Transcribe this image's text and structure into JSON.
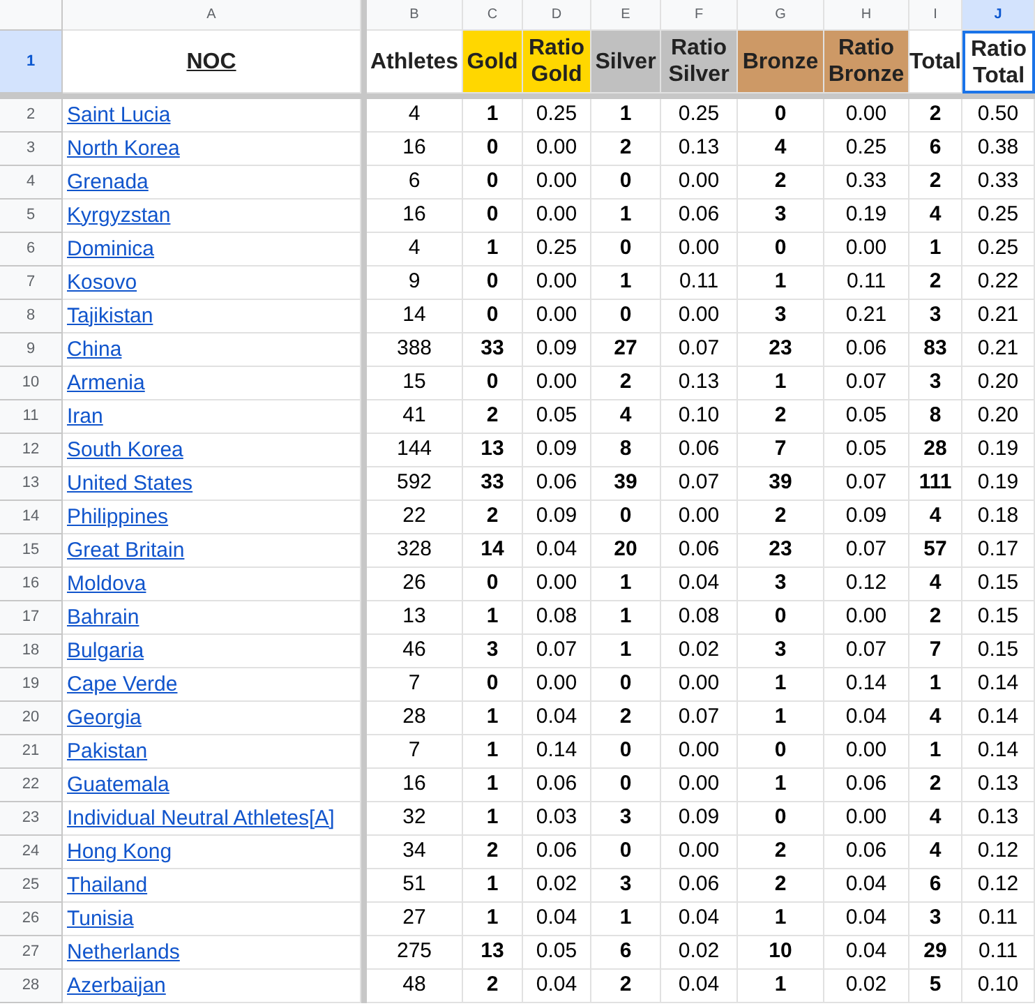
{
  "column_letters": [
    {
      "label": "A",
      "selected": false
    },
    {
      "label": "B",
      "selected": false
    },
    {
      "label": "C",
      "selected": false
    },
    {
      "label": "D",
      "selected": false
    },
    {
      "label": "E",
      "selected": false
    },
    {
      "label": "F",
      "selected": false
    },
    {
      "label": "G",
      "selected": false
    },
    {
      "label": "H",
      "selected": false
    },
    {
      "label": "I",
      "selected": false
    },
    {
      "label": "J",
      "selected": true
    }
  ],
  "header_row": {
    "row": "1",
    "selected": true,
    "cells": [
      {
        "text": "NOC",
        "color": "#ffffff",
        "selected": false
      },
      {
        "text": "Athletes",
        "color": "#ffffff",
        "selected": false
      },
      {
        "text": "Gold",
        "color": "#ffd700",
        "selected": false
      },
      {
        "text": "Ratio Gold",
        "color": "#ffd700",
        "selected": false
      },
      {
        "text": "Silver",
        "color": "#c0c0c0",
        "selected": false
      },
      {
        "text": "Ratio Silver",
        "color": "#c0c0c0",
        "selected": false
      },
      {
        "text": "Bronze",
        "color": "#cd9966",
        "selected": false
      },
      {
        "text": "Ratio Bronze",
        "color": "#cd9966",
        "selected": false
      },
      {
        "text": "Total",
        "color": "#ffffff",
        "selected": false
      },
      {
        "text": "Ratio Total",
        "color": "#ffffff",
        "selected": true
      }
    ]
  },
  "rows": [
    {
      "row": "2",
      "selected": false,
      "cells": [
        "Saint Lucia",
        "4",
        "1",
        "0.25",
        "1",
        "0.25",
        "0",
        "0.00",
        "2",
        "0.50"
      ]
    },
    {
      "row": "3",
      "selected": false,
      "cells": [
        "North Korea",
        "16",
        "0",
        "0.00",
        "2",
        "0.13",
        "4",
        "0.25",
        "6",
        "0.38"
      ]
    },
    {
      "row": "4",
      "selected": false,
      "cells": [
        "Grenada",
        "6",
        "0",
        "0.00",
        "0",
        "0.00",
        "2",
        "0.33",
        "2",
        "0.33"
      ]
    },
    {
      "row": "5",
      "selected": false,
      "cells": [
        "Kyrgyzstan",
        "16",
        "0",
        "0.00",
        "1",
        "0.06",
        "3",
        "0.19",
        "4",
        "0.25"
      ]
    },
    {
      "row": "6",
      "selected": false,
      "cells": [
        "Dominica",
        "4",
        "1",
        "0.25",
        "0",
        "0.00",
        "0",
        "0.00",
        "1",
        "0.25"
      ]
    },
    {
      "row": "7",
      "selected": false,
      "cells": [
        "Kosovo",
        "9",
        "0",
        "0.00",
        "1",
        "0.11",
        "1",
        "0.11",
        "2",
        "0.22"
      ]
    },
    {
      "row": "8",
      "selected": false,
      "cells": [
        "Tajikistan",
        "14",
        "0",
        "0.00",
        "0",
        "0.00",
        "3",
        "0.21",
        "3",
        "0.21"
      ]
    },
    {
      "row": "9",
      "selected": false,
      "cells": [
        "China",
        "388",
        "33",
        "0.09",
        "27",
        "0.07",
        "23",
        "0.06",
        "83",
        "0.21"
      ]
    },
    {
      "row": "10",
      "selected": false,
      "cells": [
        "Armenia",
        "15",
        "0",
        "0.00",
        "2",
        "0.13",
        "1",
        "0.07",
        "3",
        "0.20"
      ]
    },
    {
      "row": "11",
      "selected": false,
      "cells": [
        "Iran",
        "41",
        "2",
        "0.05",
        "4",
        "0.10",
        "2",
        "0.05",
        "8",
        "0.20"
      ]
    },
    {
      "row": "12",
      "selected": false,
      "cells": [
        "South Korea",
        "144",
        "13",
        "0.09",
        "8",
        "0.06",
        "7",
        "0.05",
        "28",
        "0.19"
      ]
    },
    {
      "row": "13",
      "selected": false,
      "cells": [
        "United States",
        "592",
        "33",
        "0.06",
        "39",
        "0.07",
        "39",
        "0.07",
        "111",
        "0.19"
      ]
    },
    {
      "row": "14",
      "selected": false,
      "cells": [
        "Philippines",
        "22",
        "2",
        "0.09",
        "0",
        "0.00",
        "2",
        "0.09",
        "4",
        "0.18"
      ]
    },
    {
      "row": "15",
      "selected": false,
      "cells": [
        "Great Britain",
        "328",
        "14",
        "0.04",
        "20",
        "0.06",
        "23",
        "0.07",
        "57",
        "0.17"
      ]
    },
    {
      "row": "16",
      "selected": false,
      "cells": [
        "Moldova",
        "26",
        "0",
        "0.00",
        "1",
        "0.04",
        "3",
        "0.12",
        "4",
        "0.15"
      ]
    },
    {
      "row": "17",
      "selected": false,
      "cells": [
        "Bahrain",
        "13",
        "1",
        "0.08",
        "1",
        "0.08",
        "0",
        "0.00",
        "2",
        "0.15"
      ]
    },
    {
      "row": "18",
      "selected": false,
      "cells": [
        "Bulgaria",
        "46",
        "3",
        "0.07",
        "1",
        "0.02",
        "3",
        "0.07",
        "7",
        "0.15"
      ]
    },
    {
      "row": "19",
      "selected": false,
      "cells": [
        "Cape Verde",
        "7",
        "0",
        "0.00",
        "0",
        "0.00",
        "1",
        "0.14",
        "1",
        "0.14"
      ]
    },
    {
      "row": "20",
      "selected": false,
      "cells": [
        "Georgia",
        "28",
        "1",
        "0.04",
        "2",
        "0.07",
        "1",
        "0.04",
        "4",
        "0.14"
      ]
    },
    {
      "row": "21",
      "selected": false,
      "cells": [
        "Pakistan",
        "7",
        "1",
        "0.14",
        "0",
        "0.00",
        "0",
        "0.00",
        "1",
        "0.14"
      ]
    },
    {
      "row": "22",
      "selected": false,
      "cells": [
        "Guatemala",
        "16",
        "1",
        "0.06",
        "0",
        "0.00",
        "1",
        "0.06",
        "2",
        "0.13"
      ]
    },
    {
      "row": "23",
      "selected": false,
      "cells": [
        "Individual Neutral Athletes[A]",
        "32",
        "1",
        "0.03",
        "3",
        "0.09",
        "0",
        "0.00",
        "4",
        "0.13"
      ]
    },
    {
      "row": "24",
      "selected": false,
      "cells": [
        "Hong Kong",
        "34",
        "2",
        "0.06",
        "0",
        "0.00",
        "2",
        "0.06",
        "4",
        "0.12"
      ]
    },
    {
      "row": "25",
      "selected": false,
      "cells": [
        "Thailand",
        "51",
        "1",
        "0.02",
        "3",
        "0.06",
        "2",
        "0.04",
        "6",
        "0.12"
      ]
    },
    {
      "row": "26",
      "selected": false,
      "cells": [
        "Tunisia",
        "27",
        "1",
        "0.04",
        "1",
        "0.04",
        "1",
        "0.04",
        "3",
        "0.11"
      ]
    },
    {
      "row": "27",
      "selected": false,
      "cells": [
        "Netherlands",
        "275",
        "13",
        "0.05",
        "6",
        "0.02",
        "10",
        "0.04",
        "29",
        "0.11"
      ]
    },
    {
      "row": "28",
      "selected": false,
      "cells": [
        "Azerbaijan",
        "48",
        "2",
        "0.04",
        "2",
        "0.04",
        "1",
        "0.02",
        "5",
        "0.10"
      ]
    }
  ]
}
